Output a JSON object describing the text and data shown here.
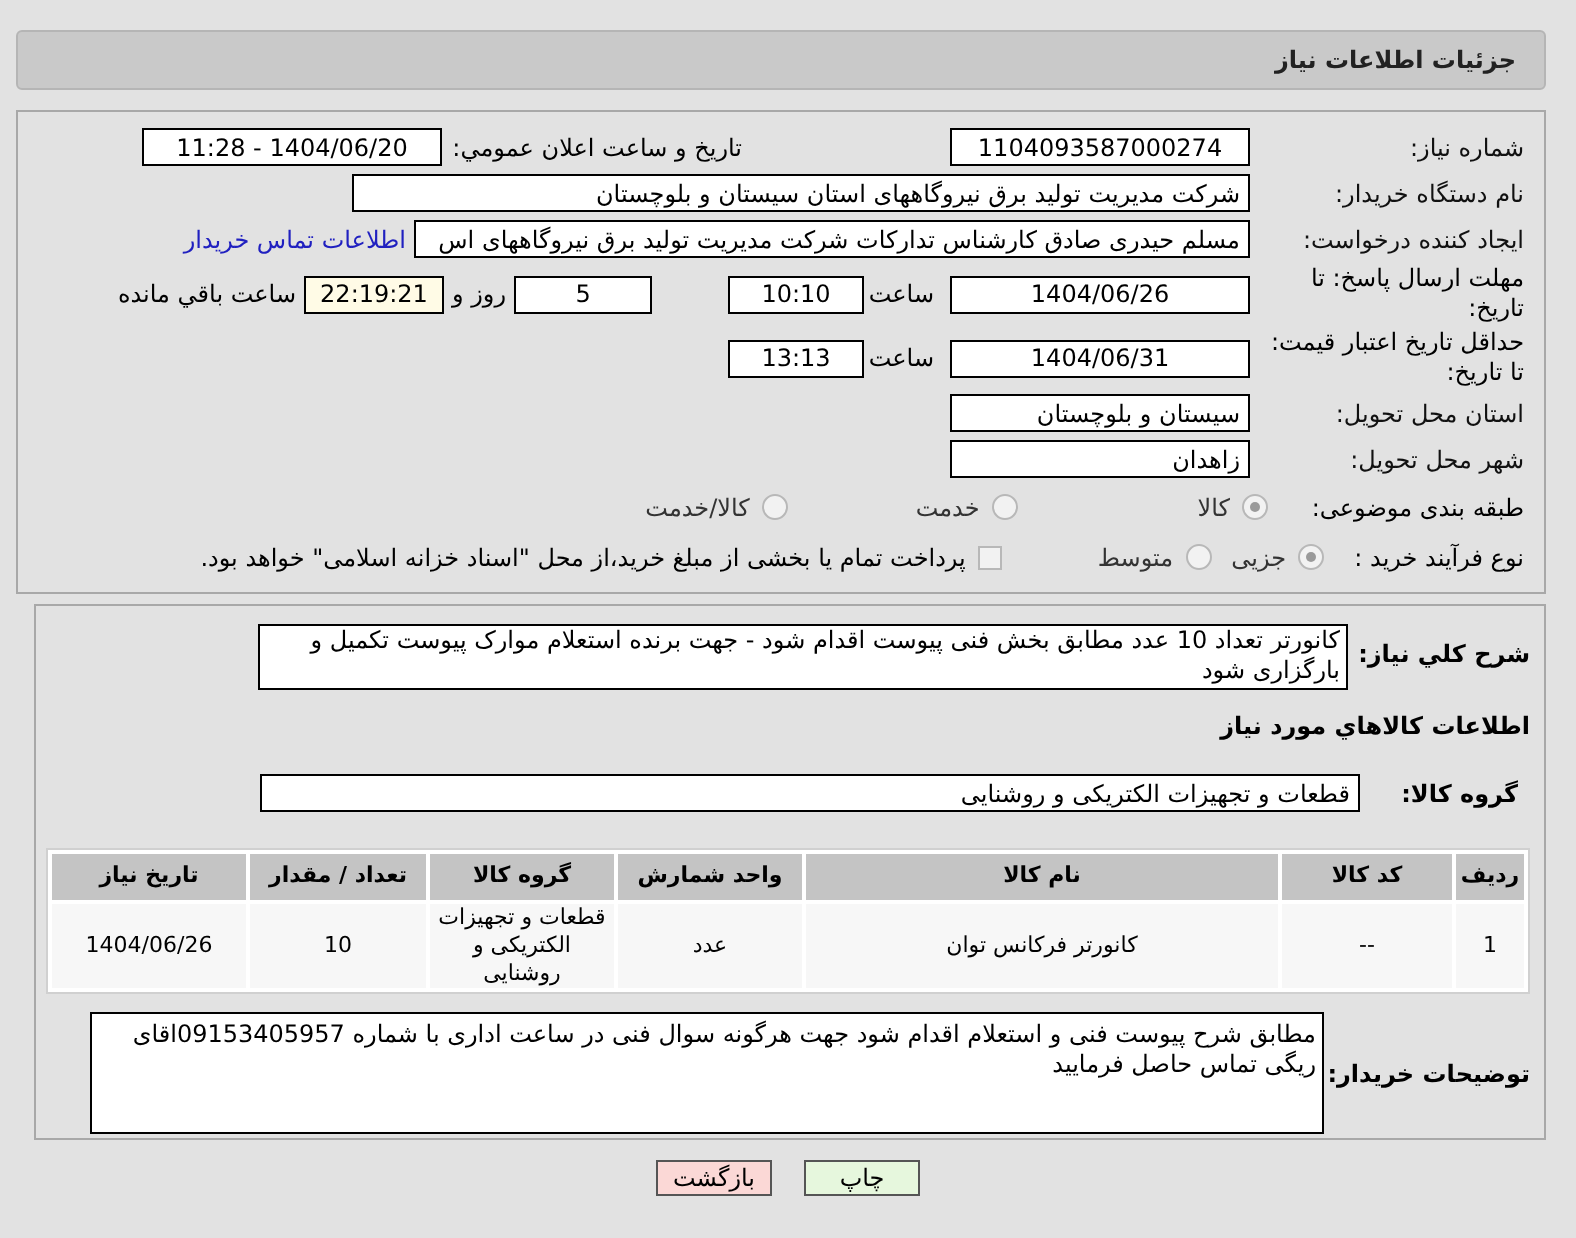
{
  "header": {
    "title": "جزئیات اطلاعات نیاز"
  },
  "need_number": {
    "label": "شماره نیاز:",
    "value": "1104093587000274"
  },
  "announce": {
    "label": "تاریخ و ساعت اعلان عمومي:",
    "value": "1404/06/20 - 11:28"
  },
  "buyer": {
    "label": "نام دستگاه خریدار:",
    "value": "شرکت مدیریت تولید برق نیروگاههای استان سیستان و بلوچستان"
  },
  "creator": {
    "label": "ایجاد کننده درخواست:",
    "value": "مسلم حیدری صادق کارشناس تدارکات شرکت مدیریت تولید برق نیروگاههای اس",
    "link": "اطلاعات تماس خریدار"
  },
  "deadline": {
    "label": "مهلت ارسال پاسخ: تا تاریخ:",
    "date": "1404/06/26",
    "time_label": "ساعت",
    "time": "10:10",
    "days": "5",
    "days_label": "روز و",
    "remaining": "22:19:21",
    "remaining_label": "ساعت باقي مانده"
  },
  "validity": {
    "label": "حداقل تاریخ اعتبار قیمت: تا تاریخ:",
    "date": "1404/06/31",
    "time_label": "ساعت",
    "time": "13:13"
  },
  "province": {
    "label": "استان محل تحویل:",
    "value": "سیستان و بلوچستان"
  },
  "city": {
    "label": "شهر محل تحویل:",
    "value": "زاهدان"
  },
  "category": {
    "label": "طبقه بندی موضوعی:",
    "options": [
      {
        "label": "کالا",
        "selected": true
      },
      {
        "label": "خدمت",
        "selected": false
      },
      {
        "label": "کالا/خدمت",
        "selected": false
      }
    ]
  },
  "process": {
    "label": "نوع فرآیند خرید :",
    "options": [
      {
        "label": "جزیی",
        "selected": true
      },
      {
        "label": "متوسط",
        "selected": false
      }
    ],
    "treasury": {
      "label": "پرداخت تمام یا بخشی از مبلغ خرید،از محل \"اسناد خزانه اسلامی\" خواهد بود.",
      "checked": false
    }
  },
  "description": {
    "label": "شرح کلي نیاز:",
    "value": "کانورتر  تعداد  10 عدد   مطابق بخش فنی پیوست اقدام شود - جهت برنده استعلام موارک پیوست تکمیل و بارگزاری شود"
  },
  "goods_heading": "اطلاعات کالاهاي مورد نیاز",
  "group": {
    "label": "گروه کالا:",
    "value": "قطعات و تجهیزات الکتریکی و روشنایی"
  },
  "table": {
    "columns": [
      "ردیف",
      "کد کالا",
      "نام کالا",
      "واحد شمارش",
      "گروه کالا",
      "تعداد / مقدار",
      "تاریخ نیاز"
    ],
    "rows": [
      [
        "1",
        "--",
        "کانورتر فرکانس توان",
        "عدد",
        "قطعات و تجهیزات الکتریکی و روشنایی",
        "10",
        "1404/06/26"
      ]
    ]
  },
  "buyer_notes": {
    "label": "توضیحات خریدار:",
    "value": "مطابق شرح پیوست فنی و استعلام اقدام شود جهت هرگونه  سوال فنی در ساعت اداری با شماره 09153405957اقای ریگی تماس حاصل فرمایید"
  },
  "buttons": [
    {
      "label": "چاپ",
      "kind": "print"
    },
    {
      "label": "بازگشت",
      "kind": "back"
    }
  ]
}
